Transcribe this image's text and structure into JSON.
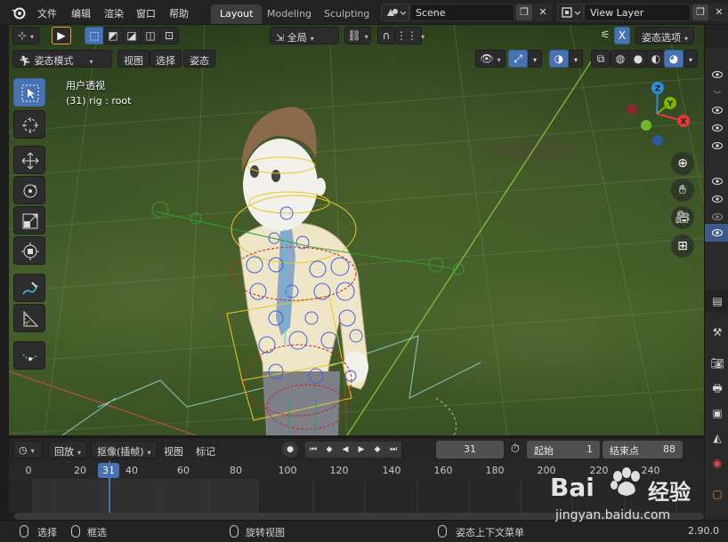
{
  "menubar": {
    "items": [
      "文件",
      "编辑",
      "渲染",
      "窗口",
      "帮助"
    ],
    "workspace_tabs": [
      "Layout",
      "Modeling",
      "Sculpting"
    ],
    "scene_name": "Scene",
    "view_layer": "View Layer"
  },
  "viewport_header": {
    "orientation_label": "全局",
    "pose_options": "姿态选项",
    "axis_x_label": "X",
    "mode_label": "姿态模式",
    "menus": [
      "视图",
      "选择",
      "姿态"
    ]
  },
  "viewport_overlay": {
    "view_name": "用户透视",
    "object_info": "(31) rig : root"
  },
  "gizmo": {
    "x": "X",
    "y": "Y",
    "z": "Z"
  },
  "timeline": {
    "playback_label": "回放",
    "keying_label": "抠像(插帧)",
    "view_label": "视图",
    "marker_label": "标记",
    "current_frame": "31",
    "start_label": "起始",
    "start_value": "1",
    "end_label": "结束点",
    "end_value": "88",
    "ruler_ticks": [
      "0",
      "20",
      "40",
      "60",
      "80",
      "100",
      "120",
      "140",
      "160",
      "180",
      "200",
      "220",
      "240"
    ],
    "ruler_current": "31"
  },
  "statusbar": {
    "select": "选择",
    "box_select": "框选",
    "rotate_view": "旋转视图",
    "context_menu": "姿态上下文菜单",
    "version": "2.90.0"
  },
  "watermark": {
    "brand_bai": "Bai",
    "brand_du": "经验",
    "url": "jingyan.baidu.com"
  },
  "colors": {
    "accent": "#4772b3",
    "axis_x": "#e5383b",
    "axis_y": "#7ab800",
    "axis_z": "#2f8cdc"
  }
}
